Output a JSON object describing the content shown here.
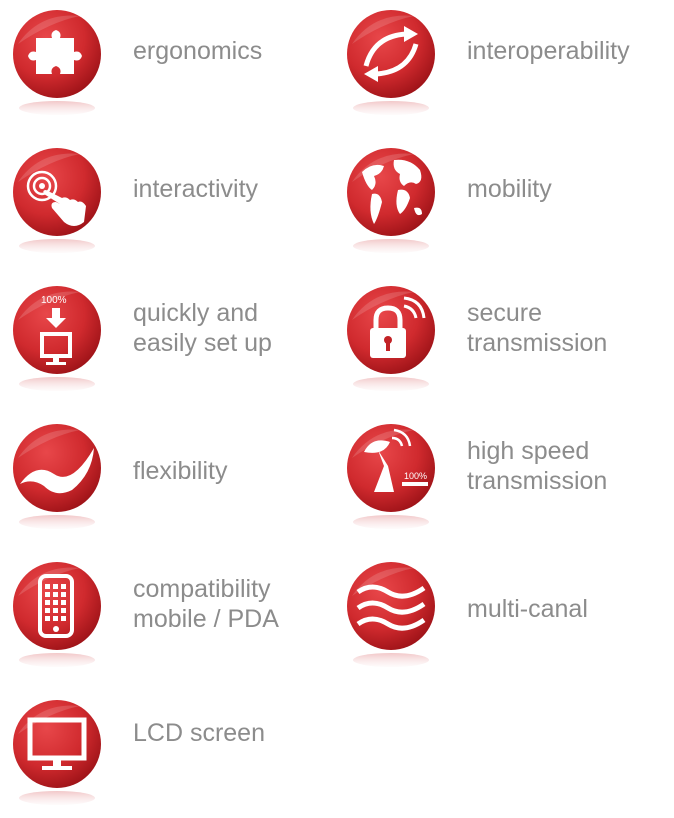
{
  "features": [
    {
      "label": "ergonomics",
      "icon": "puzzle-icon"
    },
    {
      "label": "interoperability",
      "icon": "arrows-exchange-icon"
    },
    {
      "label": "interactivity",
      "icon": "touch-hand-icon"
    },
    {
      "label": "mobility",
      "icon": "globe-icon"
    },
    {
      "label": "quickly and\neasily set up",
      "icon": "download-computer-icon",
      "icon_text": "100%"
    },
    {
      "label": "secure\ntransmission",
      "icon": "padlock-signal-icon"
    },
    {
      "label": "flexibility",
      "icon": "wave-flag-icon"
    },
    {
      "label": "high speed\ntransmission",
      "icon": "satellite-dish-icon",
      "icon_text": "100%"
    },
    {
      "label": "compatibility\nmobile / PDA",
      "icon": "smartphone-icon"
    },
    {
      "label": "multi-canal",
      "icon": "waves-icon"
    },
    {
      "label": "LCD screen",
      "icon": "monitor-icon"
    }
  ],
  "colors": {
    "badge_red": "#d42a2e",
    "badge_dark": "#a5151b",
    "label_gray": "#8c8c8c"
  }
}
